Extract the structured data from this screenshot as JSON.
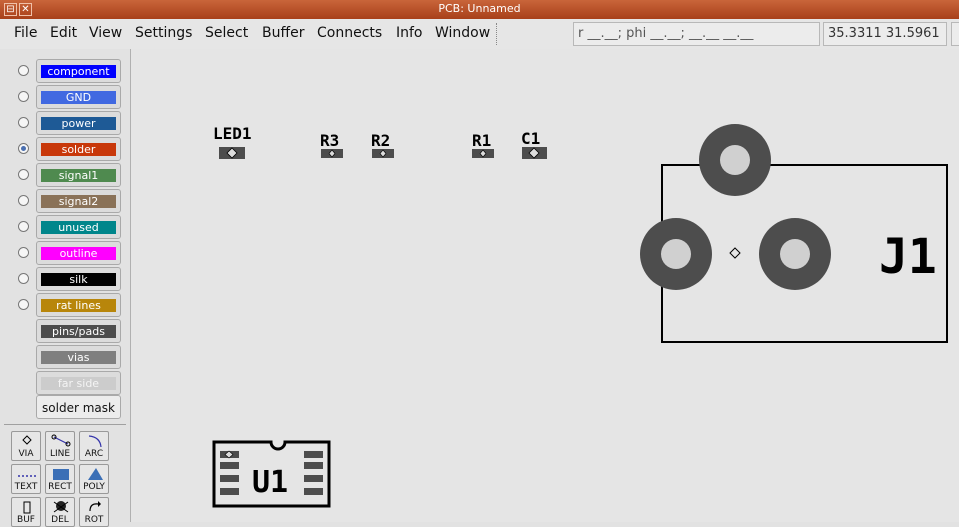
{
  "window": {
    "title": "PCB: Unnamed"
  },
  "menu": {
    "items": [
      "File",
      "Edit",
      "View",
      "Settings",
      "Select",
      "Buffer",
      "Connects",
      "Info",
      "Window"
    ]
  },
  "status": {
    "polar": "r __.__; phi __.__; __.__ __.__",
    "coords": "35.3311 31.5961"
  },
  "layers": [
    {
      "label": "component",
      "color": "#0000ff",
      "selected": false
    },
    {
      "label": "GND",
      "color": "#4169e1",
      "selected": false
    },
    {
      "label": "power",
      "color": "#1e5a96",
      "selected": false
    },
    {
      "label": "solder",
      "color": "#c8380a",
      "selected": true
    },
    {
      "label": "signal1",
      "color": "#4f8a4f",
      "selected": false
    },
    {
      "label": "signal2",
      "color": "#8a7258",
      "selected": false
    },
    {
      "label": "unused",
      "color": "#00868b",
      "selected": false
    },
    {
      "label": "outline",
      "color": "#ff00ff",
      "selected": false
    },
    {
      "label": "silk",
      "color": "#000000",
      "selected": false
    },
    {
      "label": "rat lines",
      "color": "#b8860b",
      "selected": false
    },
    {
      "label": "pins/pads",
      "color": "#4d4d4d",
      "selected": null
    },
    {
      "label": "vias",
      "color": "#7f7f7f",
      "selected": null
    },
    {
      "label": "far side",
      "color": "#cccccc",
      "selected": null
    }
  ],
  "solder_mask": {
    "label": "solder mask"
  },
  "tools": [
    {
      "label": "VIA",
      "icon": "via-icon"
    },
    {
      "label": "LINE",
      "icon": "line-icon"
    },
    {
      "label": "ARC",
      "icon": "arc-icon"
    },
    {
      "label": "TEXT",
      "icon": "text-icon"
    },
    {
      "label": "RECT",
      "icon": "rect-icon"
    },
    {
      "label": "POLY",
      "icon": "poly-icon"
    },
    {
      "label": "BUF",
      "icon": "buffer-icon"
    },
    {
      "label": "DEL",
      "icon": "delete-icon"
    },
    {
      "label": "ROT",
      "icon": "rotate-icon"
    }
  ],
  "board": {
    "components": [
      {
        "ref": "LED1"
      },
      {
        "ref": "R3"
      },
      {
        "ref": "R2"
      },
      {
        "ref": "R1"
      },
      {
        "ref": "C1"
      },
      {
        "ref": "J1"
      },
      {
        "ref": "U1"
      }
    ]
  }
}
